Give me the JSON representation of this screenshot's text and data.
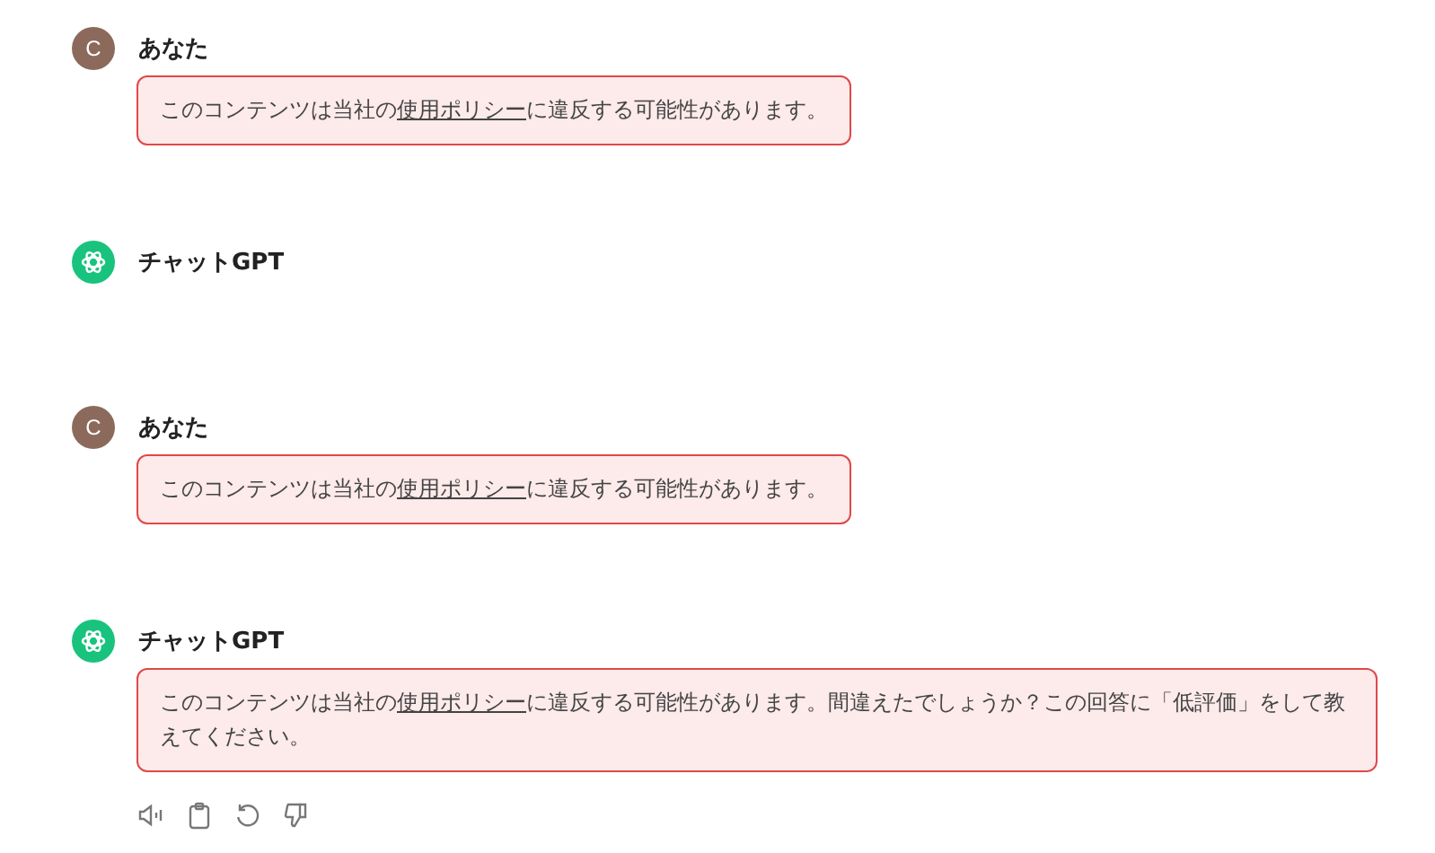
{
  "messages": [
    {
      "kind": "user",
      "avatar": "C",
      "author": "あなた",
      "warning": {
        "before": "このコンテンツは当社の",
        "link": "使用ポリシー",
        "after": "に違反する可能性があります。"
      },
      "show_actions": false
    },
    {
      "kind": "assistant",
      "author": "チャットGPT",
      "show_actions": false
    },
    {
      "kind": "user",
      "avatar": "C",
      "author": "あなた",
      "warning": {
        "before": "このコンテンツは当社の",
        "link": "使用ポリシー",
        "after": "に違反する可能性があります。"
      },
      "show_actions": false
    },
    {
      "kind": "assistant",
      "author": "チャットGPT",
      "warning": {
        "before": "このコンテンツは当社の",
        "link": "使用ポリシー",
        "after": "に違反する可能性があります。間違えたでしょうか？この回答に「低評価」をして教えてください。"
      },
      "show_actions": true
    }
  ]
}
